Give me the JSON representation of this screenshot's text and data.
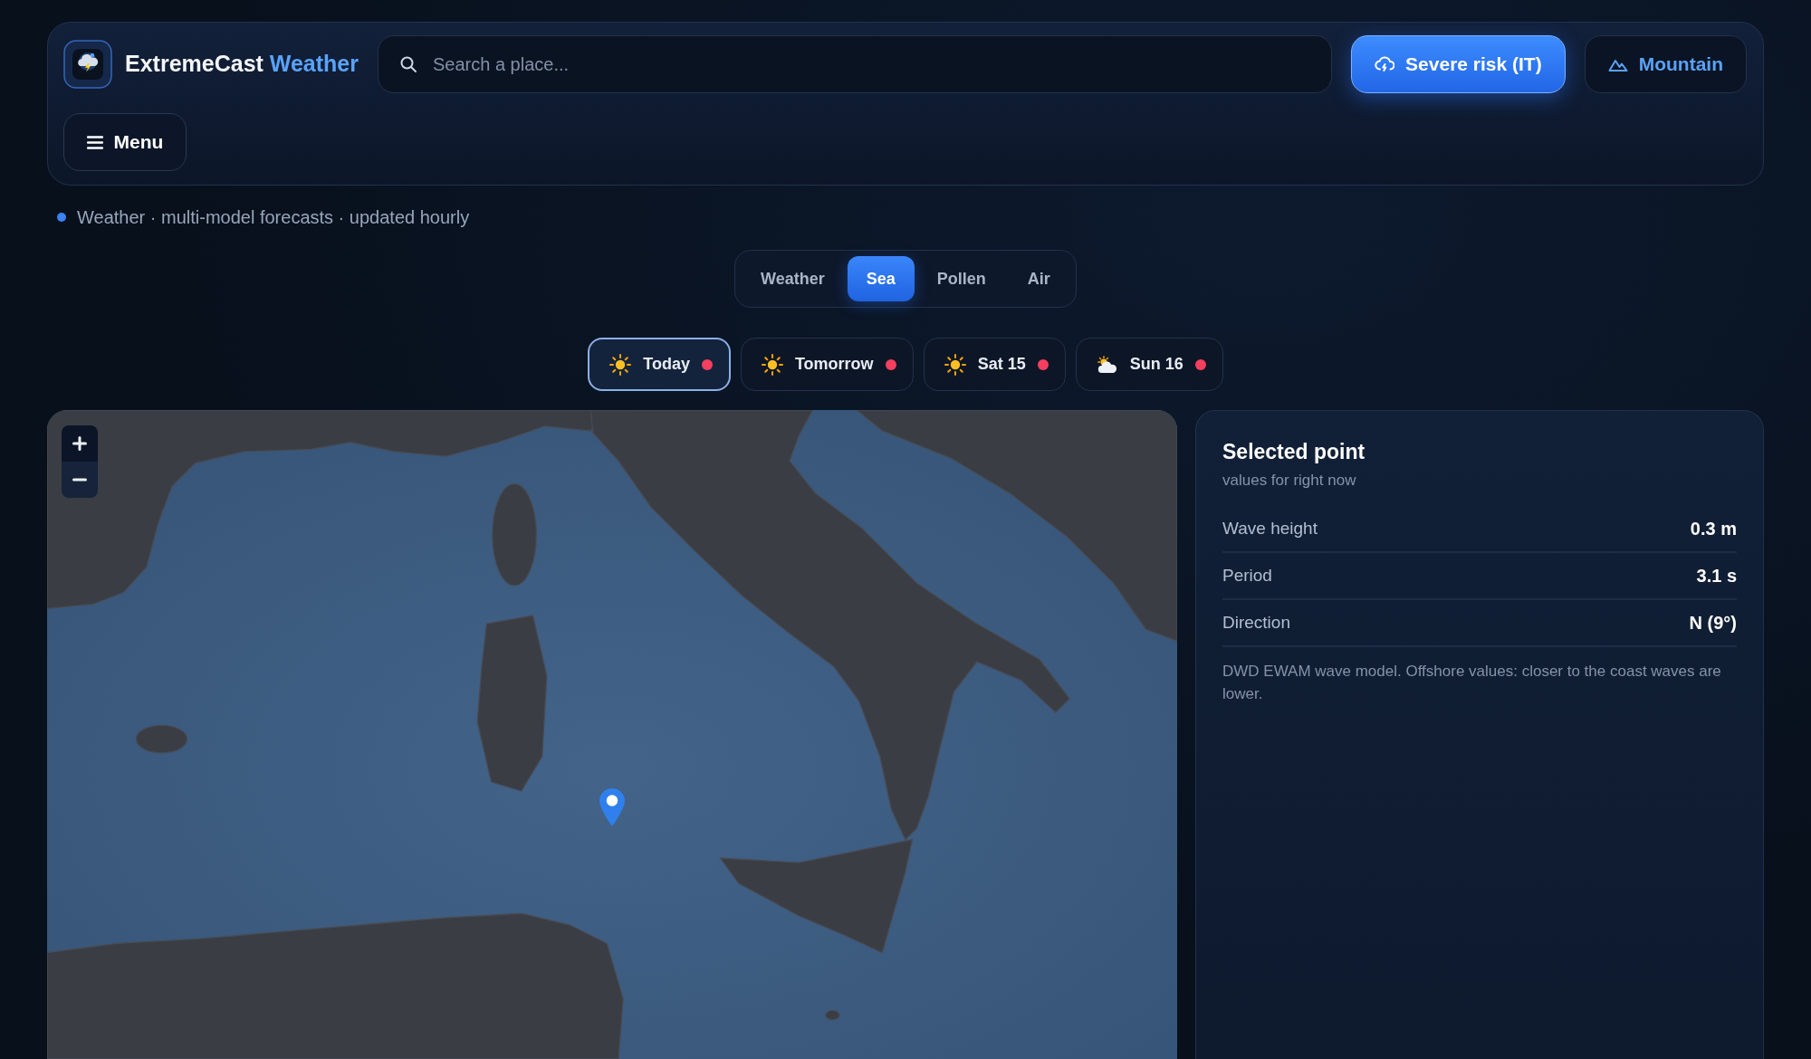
{
  "header": {
    "brand": {
      "name": "ExtremeCast",
      "accent": "Weather"
    },
    "search": {
      "placeholder": "Search a place..."
    },
    "buttons": [
      {
        "label": "Severe risk (IT)",
        "kind": "alert"
      },
      {
        "label": "Mountain",
        "kind": "mountain"
      }
    ],
    "menu_button": {
      "label": "Menu"
    }
  },
  "status_line": "Weather · multi-model forecasts · updated hourly",
  "tabs": [
    {
      "label": "Weather",
      "selected": false
    },
    {
      "label": "Sea",
      "selected": true
    },
    {
      "label": "Pollen",
      "selected": false
    },
    {
      "label": "Air",
      "selected": false
    }
  ],
  "days": [
    {
      "label": "Today",
      "kind": "sunny",
      "selected": true,
      "color": "#f43f5e"
    },
    {
      "label": "Tomorrow",
      "kind": "sunny",
      "selected": false,
      "color": "#f43f5e"
    },
    {
      "label": "Sat 15",
      "kind": "sunny",
      "selected": false,
      "color": "#f43f5e"
    },
    {
      "label": "Sun 16",
      "kind": "partly-cloudy",
      "selected": false,
      "color": "#f43f5e"
    }
  ],
  "selected_point": {
    "title": "Selected point",
    "subtitle": "values for right now",
    "rows": [
      {
        "label": "Wave height",
        "value": "0.3 m"
      },
      {
        "label": "Period",
        "value": "3.1 s"
      },
      {
        "label": "Direction",
        "value": "N (9°)"
      }
    ],
    "note": "DWD EWAM wave model. Offshore values: closer to the coast waves are lower."
  }
}
